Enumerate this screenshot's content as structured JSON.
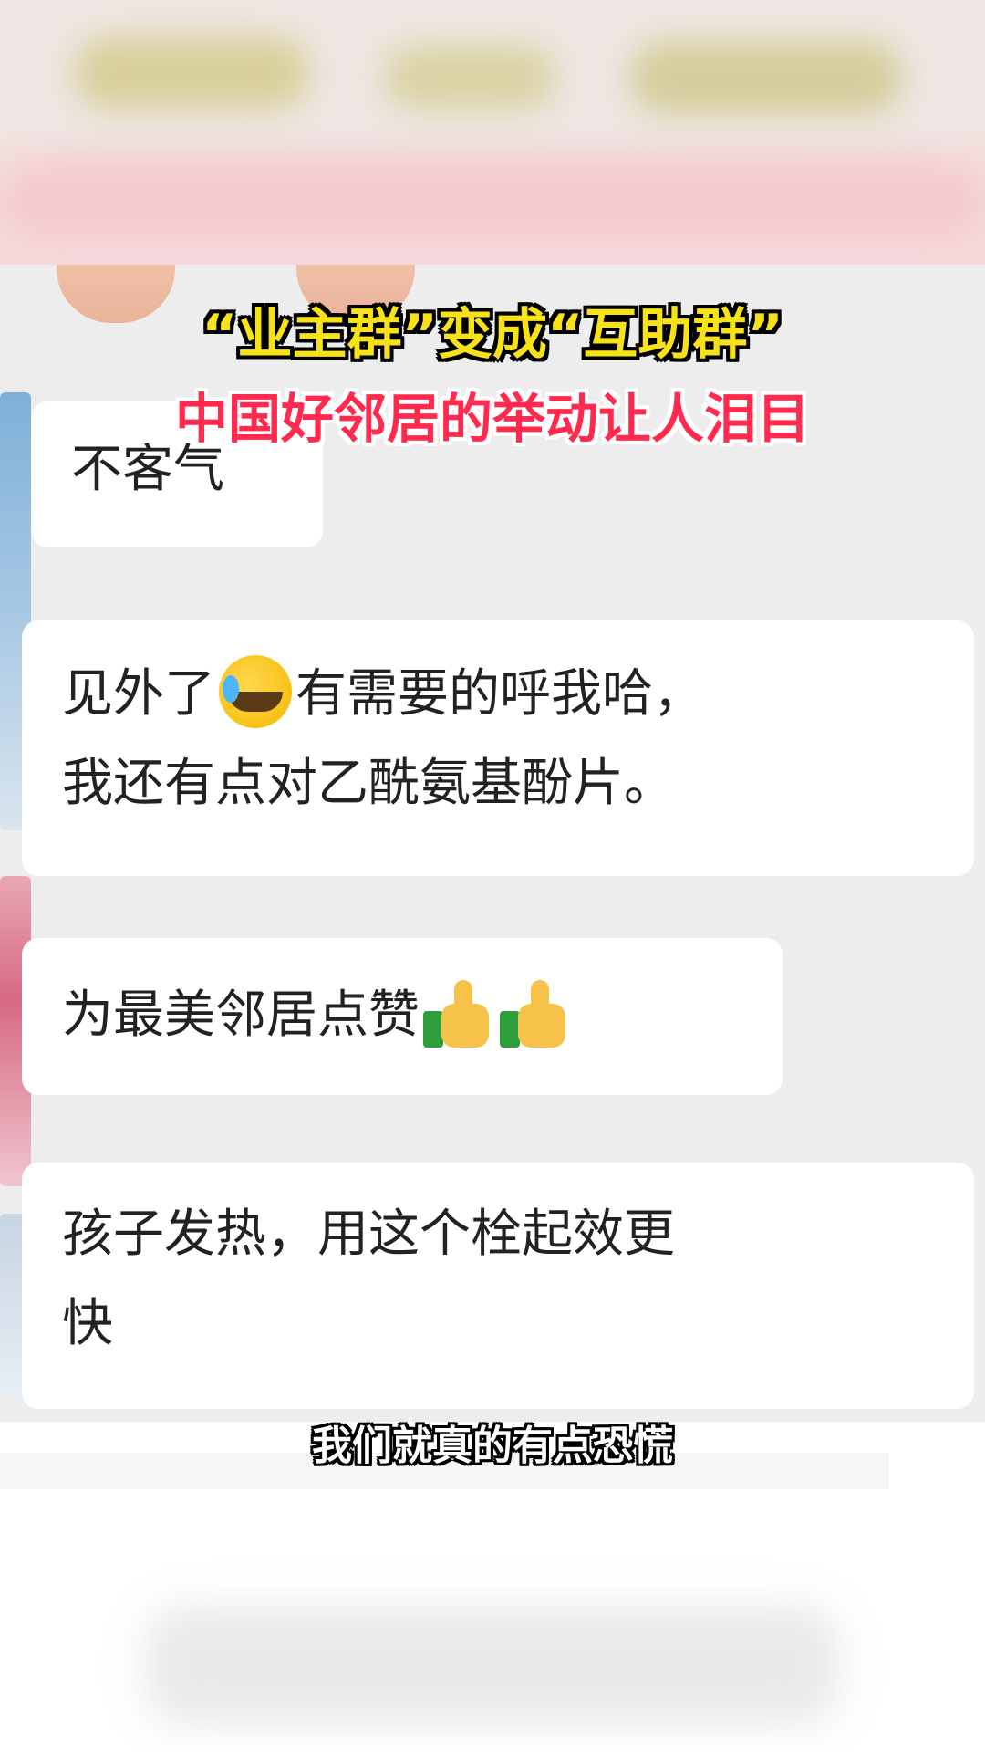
{
  "headline": {
    "line1": "“业主群”变成“互助群”",
    "line2": "中国好邻居的举动让人泪目"
  },
  "messages": [
    {
      "text": "不客气"
    },
    {
      "line1_before": "见外了",
      "line1_emoji": "loudly-crying-face-icon",
      "line1_after": "有需要的呼我哈，",
      "line2": "我还有点对乙酰氨基酚片。"
    },
    {
      "text": "为最美邻居点赞",
      "emojis": [
        "thumbs-up-icon",
        "thumbs-up-icon"
      ]
    },
    {
      "line1": "孩子发热，用这个栓起效更",
      "line2": "快"
    }
  ],
  "subtitle": "我们就真的有点恐慌",
  "colors": {
    "headline1": "#f7e21a",
    "headline2": "#ff2a4d",
    "chat_background": "#ededed",
    "bubble": "#ffffff"
  }
}
